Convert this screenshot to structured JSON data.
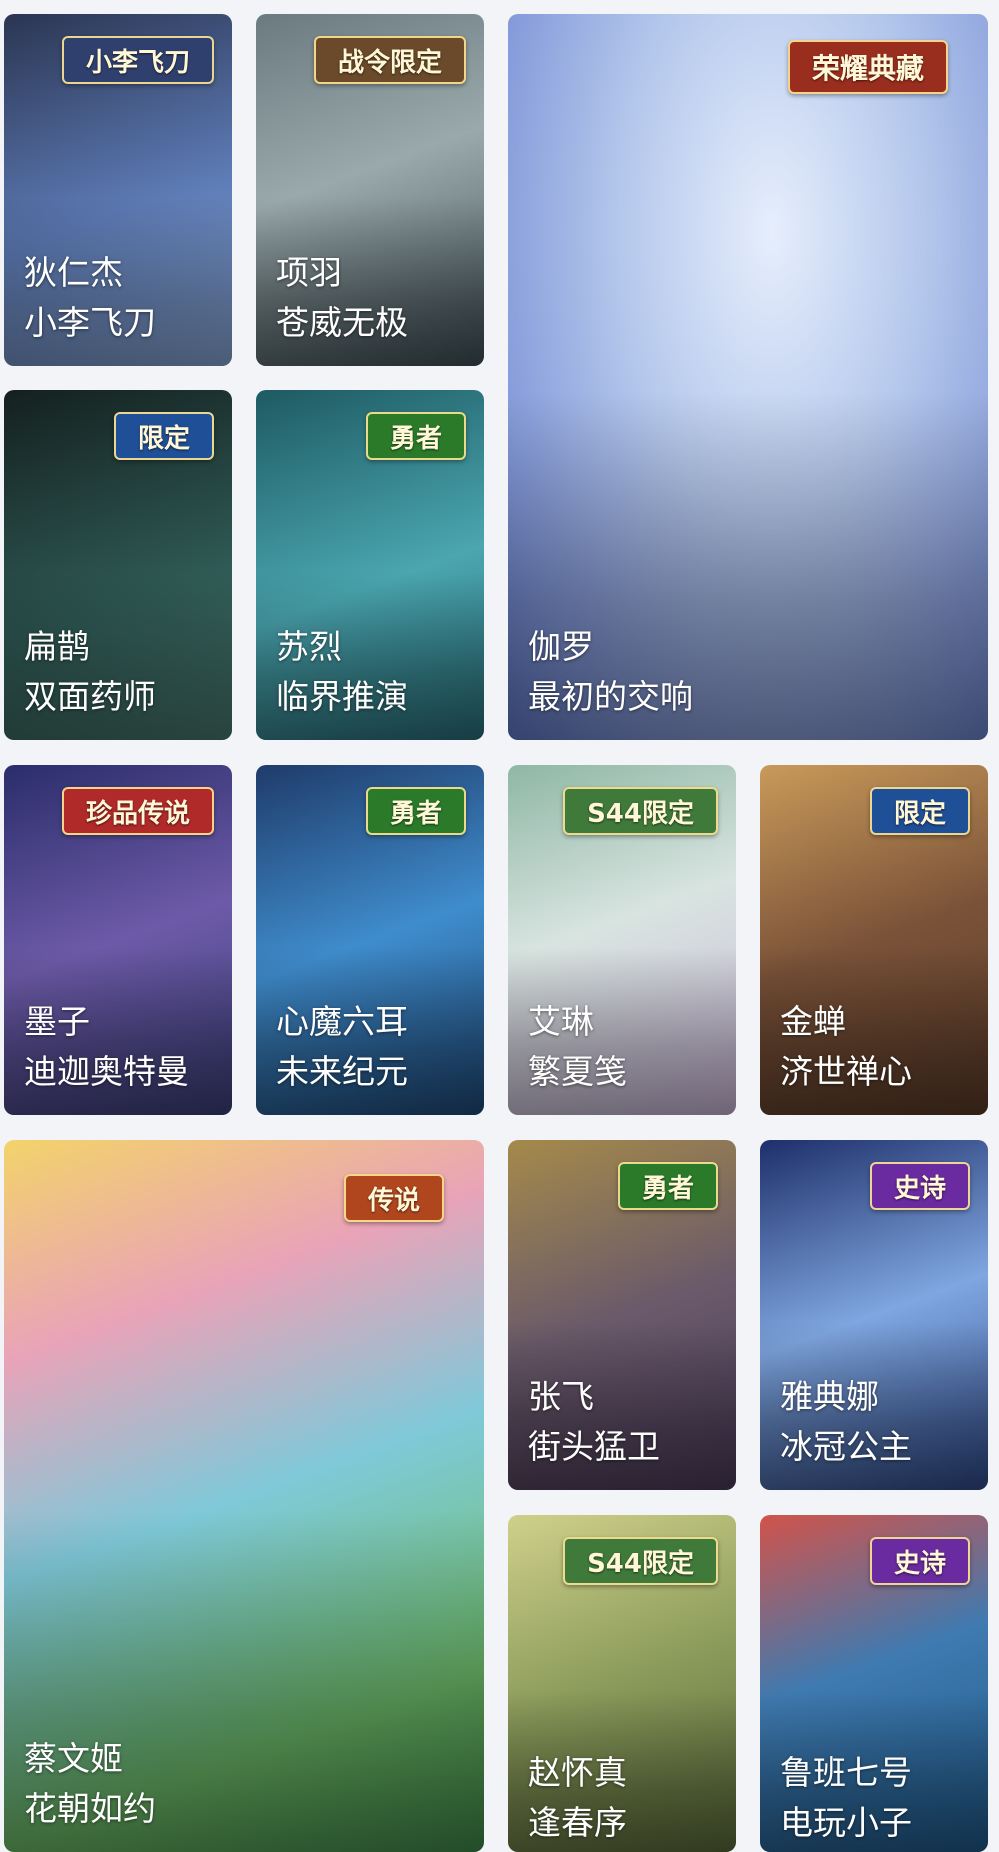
{
  "cards": [
    {
      "hero": "狄仁杰",
      "skin": "小李飞刀",
      "badge": "小李飞刀",
      "colors": [
        "#2b3552",
        "#6a8fc0"
      ],
      "badge_color": "#30406e"
    },
    {
      "hero": "项羽",
      "skin": "苍威无极",
      "badge": "战令限定",
      "colors": [
        "#3f4e55",
        "#a4b2b4"
      ],
      "badge_color": "#6a4a2a"
    },
    {
      "hero": "伽罗",
      "skin": "最初的交响",
      "badge": "荣耀典藏",
      "colors": [
        "#b5c8ec",
        "#5f78c8"
      ],
      "badge_color": "#9a2e1e"
    },
    {
      "hero": "扁鹊",
      "skin": "双面药师",
      "badge": "限定",
      "colors": [
        "#1b2a2a",
        "#2f5a55"
      ],
      "badge_color": "#1f4f96"
    },
    {
      "hero": "苏烈",
      "skin": "临界推演",
      "badge": "勇者",
      "colors": [
        "#1e5a62",
        "#4aa6b0"
      ],
      "badge_color": "#2a7a2a"
    },
    {
      "hero": "墨子",
      "skin": "迪迦奥特曼",
      "badge": "珍品传说",
      "colors": [
        "#2a2d6a",
        "#6d5aa8"
      ],
      "badge_color": "#b02a2a"
    },
    {
      "hero": "心魔六耳",
      "skin": "未来纪元",
      "badge": "勇者",
      "colors": [
        "#1f3b6a",
        "#3f8ccc"
      ],
      "badge_color": "#2a7a2a"
    },
    {
      "hero": "艾琳",
      "skin": "繁夏笺",
      "badge": "S44限定",
      "colors": [
        "#8fb7a5",
        "#c9b6d8"
      ],
      "badge_color": "#3f7a3a"
    },
    {
      "hero": "金蝉",
      "skin": "济世禅心",
      "badge": "限定",
      "colors": [
        "#5a3a28",
        "#c99a5a"
      ],
      "badge_color": "#1f4f96"
    },
    {
      "hero": "蔡文姬",
      "skin": "花朝如约",
      "badge": "传说",
      "colors": [
        "#6fbf6a",
        "#e2d07a"
      ],
      "badge_color": "#b0461e"
    },
    {
      "hero": "张飞",
      "skin": "街头猛卫",
      "badge": "勇者",
      "colors": [
        "#4a3a5a",
        "#a58a4a"
      ],
      "badge_color": "#2a7a2a"
    },
    {
      "hero": "雅典娜",
      "skin": "冰冠公主",
      "badge": "史诗",
      "colors": [
        "#1e2f6a",
        "#7fa6e0"
      ],
      "badge_color": "#6a2aa0"
    },
    {
      "hero": "赵怀真",
      "skin": "逢春序",
      "badge": "S44限定",
      "colors": [
        "#5a6a3a",
        "#cfd08a"
      ],
      "badge_color": "#3f7a3a"
    },
    {
      "hero": "鲁班七号",
      "skin": "电玩小子",
      "badge": "史诗",
      "colors": [
        "#1f5a8a",
        "#d2534a"
      ],
      "badge_color": "#6a2aa0"
    }
  ]
}
